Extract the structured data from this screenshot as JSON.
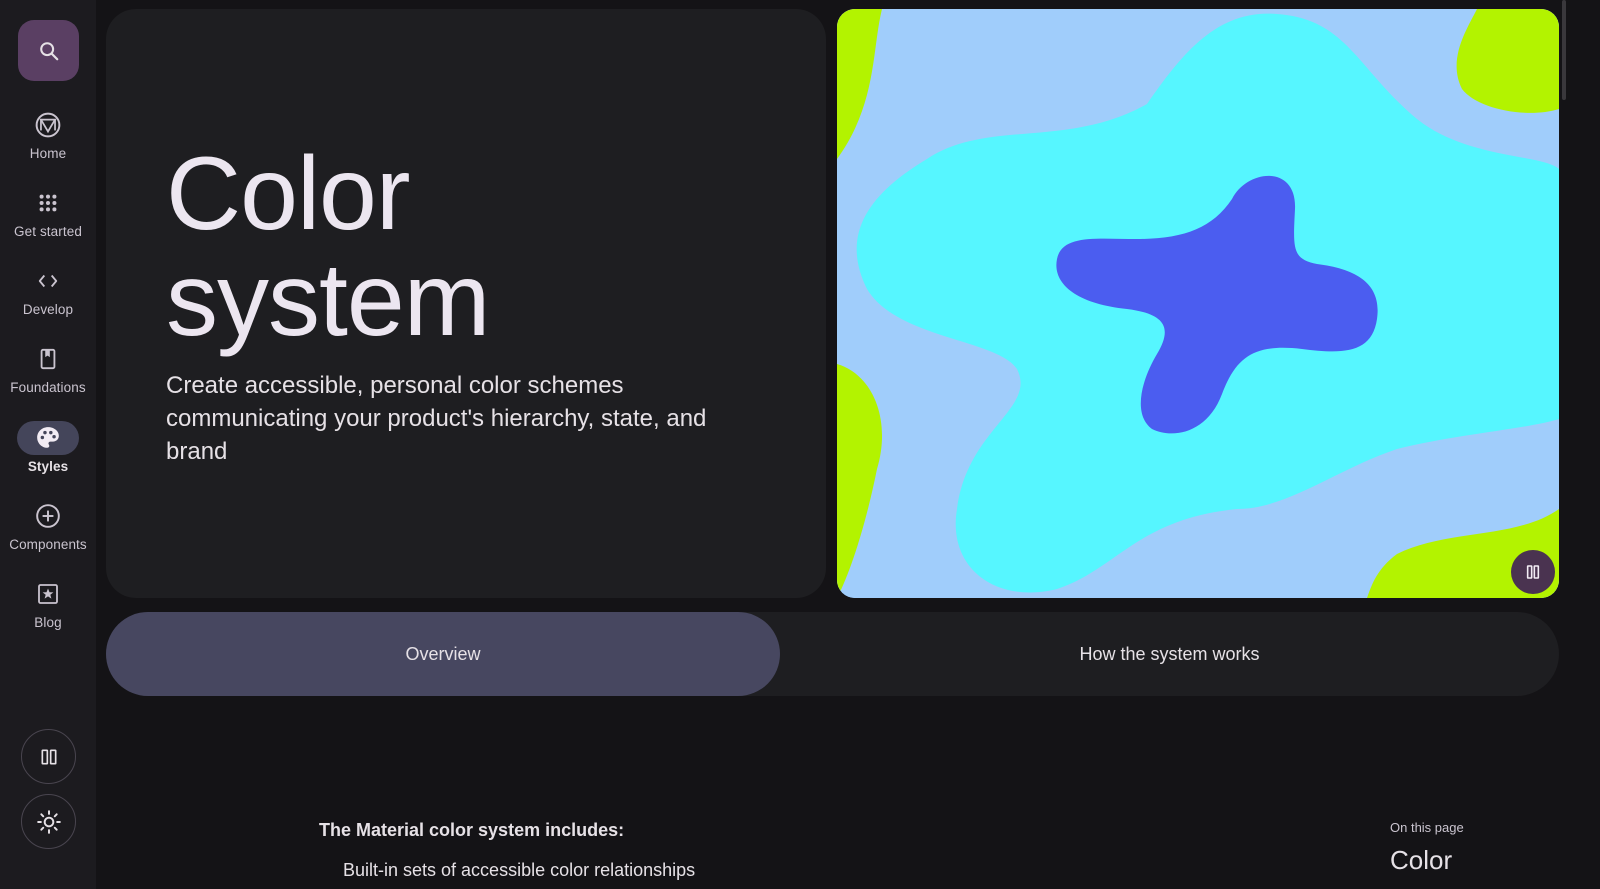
{
  "nav": {
    "search_icon": "search-icon",
    "items": [
      {
        "label": "Home",
        "icon": "material-logo-icon"
      },
      {
        "label": "Get started",
        "icon": "apps-grid-icon"
      },
      {
        "label": "Develop",
        "icon": "code-icon"
      },
      {
        "label": "Foundations",
        "icon": "book-icon"
      },
      {
        "label": "Styles",
        "icon": "palette-icon",
        "active": true
      },
      {
        "label": "Components",
        "icon": "add-circle-icon"
      },
      {
        "label": "Blog",
        "icon": "star-box-icon"
      }
    ],
    "bottom_buttons": [
      "pause-icon",
      "brightness-icon"
    ]
  },
  "hero": {
    "title_line1": "Color",
    "title_line2": "system",
    "subtitle": "Create accessible, personal color schemes communicating your product's hierarchy, state, and brand"
  },
  "art": {
    "colors": {
      "background": "#a0cdfb",
      "lime": "#b3f300",
      "cyan": "#56f6ff",
      "blue": "#4b5df0"
    },
    "pause_icon": "pause-icon"
  },
  "tabs": [
    {
      "label": "Overview",
      "active": true
    },
    {
      "label": "How the system works",
      "active": false
    }
  ],
  "content": {
    "heading": "The Material color system includes:",
    "clipped_line": "Built-in sets of accessible color relationships"
  },
  "toc": {
    "label": "On this page",
    "first_item": "Color"
  }
}
